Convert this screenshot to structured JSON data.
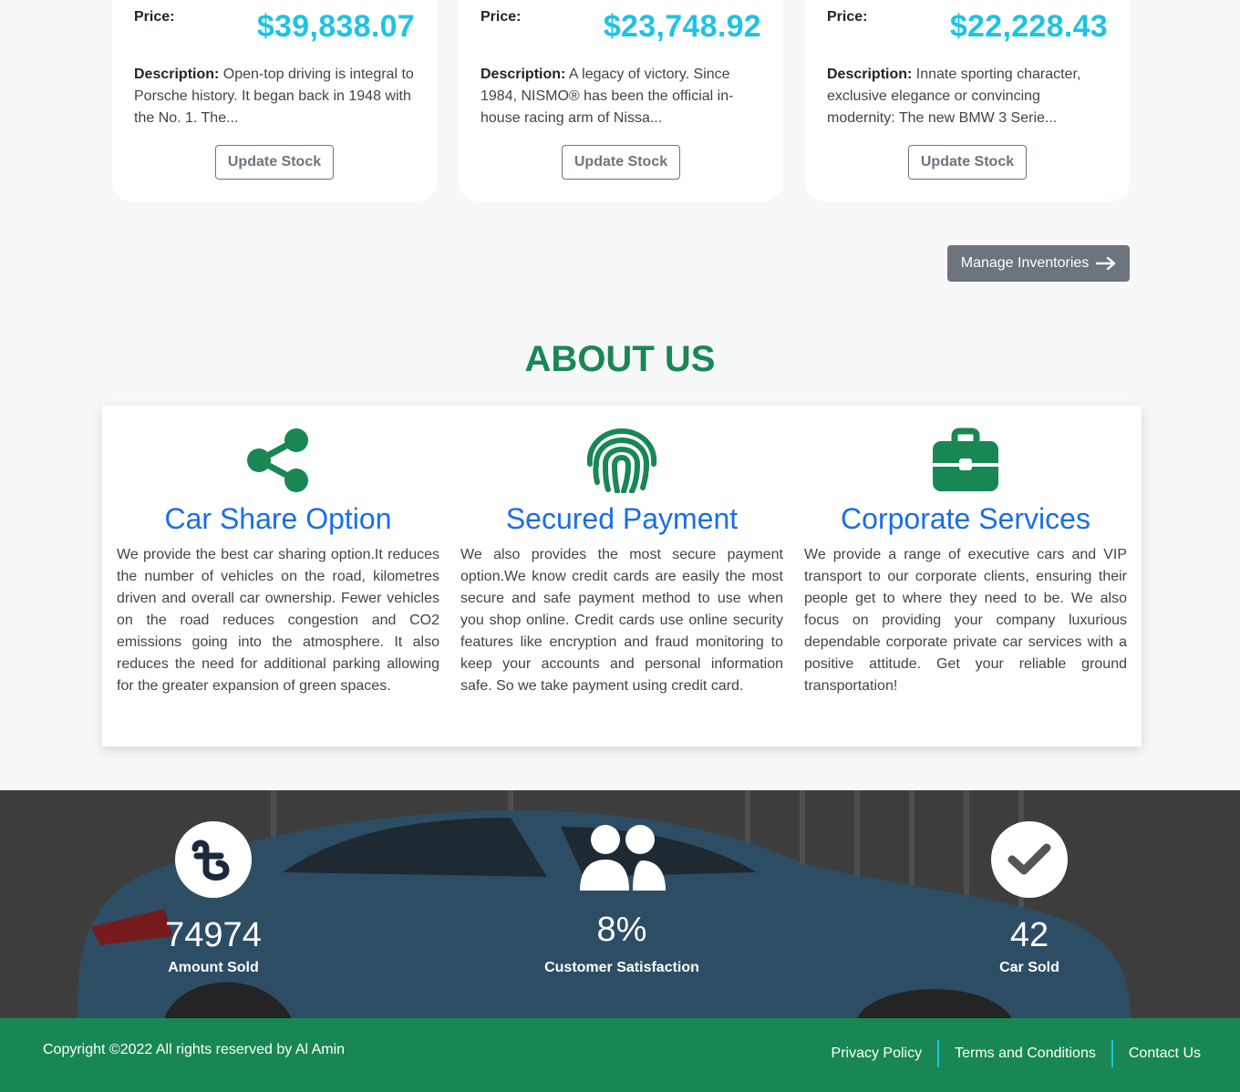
{
  "cards": [
    {
      "price_label": "Price:",
      "price": "$39,838.07",
      "desc_label": "Description:",
      "desc": " Open-top driving is integral to Porsche history. It began back in 1948 with the No. 1. The...",
      "button": "Update Stock"
    },
    {
      "price_label": "Price:",
      "price": "$23,748.92",
      "desc_label": "Description:",
      "desc": " A legacy of victory. Since 1984, NISMO® has been the official in-house racing arm of Nissa...",
      "button": "Update Stock"
    },
    {
      "price_label": "Price:",
      "price": "$22,228.43",
      "desc_label": "Description:",
      "desc": " Innate sporting character, exclusive elegance or convincing modernity: The new BMW 3 Serie...",
      "button": "Update Stock"
    }
  ],
  "manage_button": {
    "label": "Manage Inventories",
    "icon": "arrow-right-icon"
  },
  "about": {
    "title": "ABOUT US",
    "features": [
      {
        "icon": "share-icon",
        "title": "Car Share Option",
        "text": "We provide the best car sharing option.It reduces the number of vehicles on the road, kilometres driven and overall car ownership. Fewer vehicles on the road reduces congestion and CO2 emissions going into the atmosphere. It also reduces the need for additional parking allowing for the greater expansion of green spaces."
      },
      {
        "icon": "fingerprint-icon",
        "title": "Secured Payment",
        "text": "We also provides the most secure payment option.We know credit cards are easily the most secure and safe payment method to use when you shop online. Credit cards use online security features like encryption and fraud monitoring to keep your accounts and personal information safe. So we take payment using credit card."
      },
      {
        "icon": "briefcase-icon",
        "title": "Corporate Services",
        "text": "We provide a range of executive cars and VIP transport to our corporate clients, ensuring their people get to where they need to be. We also focus on providing your company luxurious dependable corporate private car services with a positive attitude. Get your reliable ground transportation!"
      }
    ]
  },
  "stats": [
    {
      "icon": "taka-icon",
      "value": "74974",
      "label": "Amount Sold"
    },
    {
      "icon": "users-icon",
      "value": "8%",
      "label": "Customer Satisfaction"
    },
    {
      "icon": "check-circle-icon",
      "value": "42",
      "label": "Car Sold"
    }
  ],
  "footer": {
    "copyright": "Copyright ©2022 All rights reserved by Al Amin",
    "links": [
      "Privacy Policy",
      "Terms and Conditions",
      "Contact Us"
    ]
  },
  "colors": {
    "accent_green": "#198754",
    "price_cyan": "#1cc4e3",
    "feature_blue": "#1a6ee6",
    "secondary_gray": "#6c757d"
  }
}
